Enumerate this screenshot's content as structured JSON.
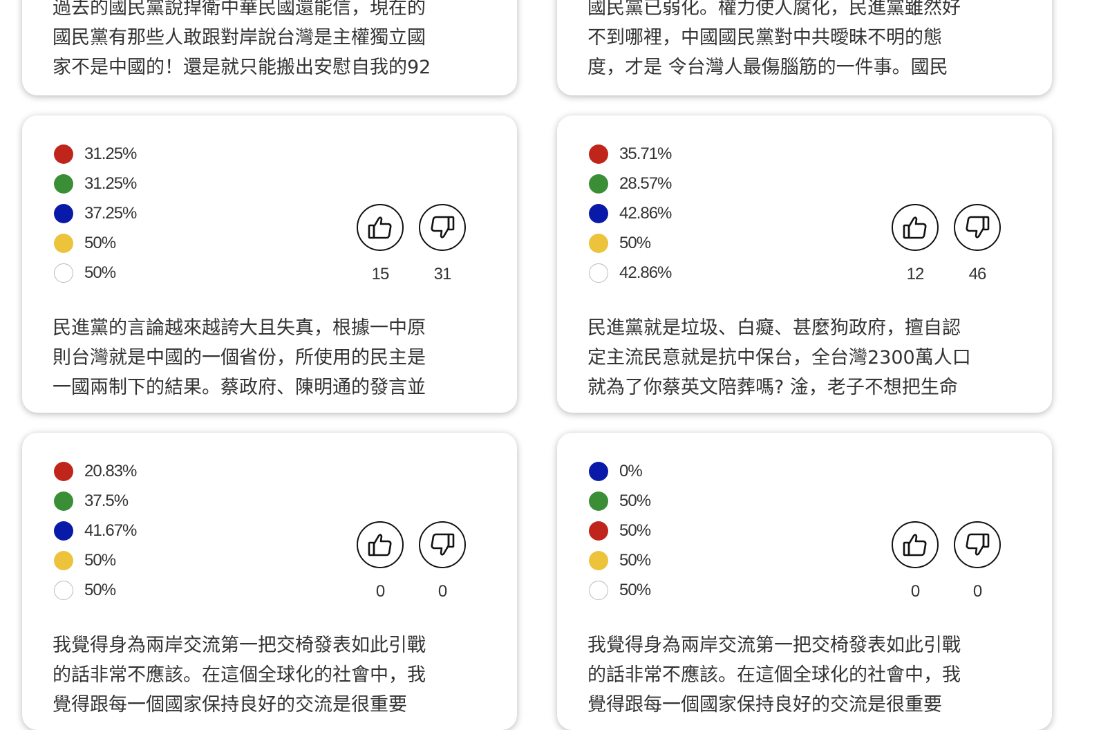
{
  "cards": [
    {
      "comment": "過去的國民黨說捍衛中華民國還能信，現在的\n國民黨有那些人敢跟對岸說台灣是主權獨立國\n家不是中國的！還是就只能搬出安慰自我的92"
    },
    {
      "comment": "國民黨已弱化。權力使人腐化，民進黨雖然好\n不到哪裡，中國國民黨對中共曖昧不明的態\n度，才是 令台灣人最傷腦筋的一件事。國民"
    },
    {
      "stats": [
        {
          "color": "#c0251c",
          "value": "31.25%"
        },
        {
          "color": "#3a8f36",
          "value": "31.25%"
        },
        {
          "color": "#0a1aa8",
          "value": "37.25%"
        },
        {
          "color": "#ecc33a",
          "value": "50%"
        },
        {
          "color": "#ffffff",
          "value": "50%"
        }
      ],
      "likes": "15",
      "dislikes": "31",
      "comment": "民進黨的言論越來越誇大且失真，根據一中原\n則台灣就是中國的一個省份，所使用的民主是\n一國兩制下的結果。蔡政府、陳明通的發言並"
    },
    {
      "stats": [
        {
          "color": "#c0251c",
          "value": "35.71%"
        },
        {
          "color": "#3a8f36",
          "value": "28.57%"
        },
        {
          "color": "#0a1aa8",
          "value": "42.86%"
        },
        {
          "color": "#ecc33a",
          "value": "50%"
        },
        {
          "color": "#ffffff",
          "value": "42.86%"
        }
      ],
      "likes": "12",
      "dislikes": "46",
      "comment": "民進黨就是垃圾、白癡、甚麼狗政府，擅自認\n定主流民意就是抗中保台，全台灣2300萬人口\n就為了你蔡英文陪葬嗎? 淦，老子不想把生命"
    },
    {
      "stats": [
        {
          "color": "#c0251c",
          "value": "20.83%"
        },
        {
          "color": "#3a8f36",
          "value": "37.5%"
        },
        {
          "color": "#0a1aa8",
          "value": "41.67%"
        },
        {
          "color": "#ecc33a",
          "value": "50%"
        },
        {
          "color": "#ffffff",
          "value": "50%"
        }
      ],
      "likes": "0",
      "dislikes": "0",
      "comment": "我覺得身為兩岸交流第一把交椅發表如此引戰\n的話非常不應該。在這個全球化的社會中，我\n覺得跟每一個國家保持良好的交流是很重要"
    },
    {
      "stats": [
        {
          "color": "#0a1aa8",
          "value": "0%"
        },
        {
          "color": "#3a8f36",
          "value": "50%"
        },
        {
          "color": "#c0251c",
          "value": "50%"
        },
        {
          "color": "#ecc33a",
          "value": "50%"
        },
        {
          "color": "#ffffff",
          "value": "50%"
        }
      ],
      "likes": "0",
      "dislikes": "0",
      "comment": "我覺得身為兩岸交流第一把交椅發表如此引戰\n的話非常不應該。在這個全球化的社會中，我\n覺得跟每一個國家保持良好的交流是很重要"
    }
  ]
}
